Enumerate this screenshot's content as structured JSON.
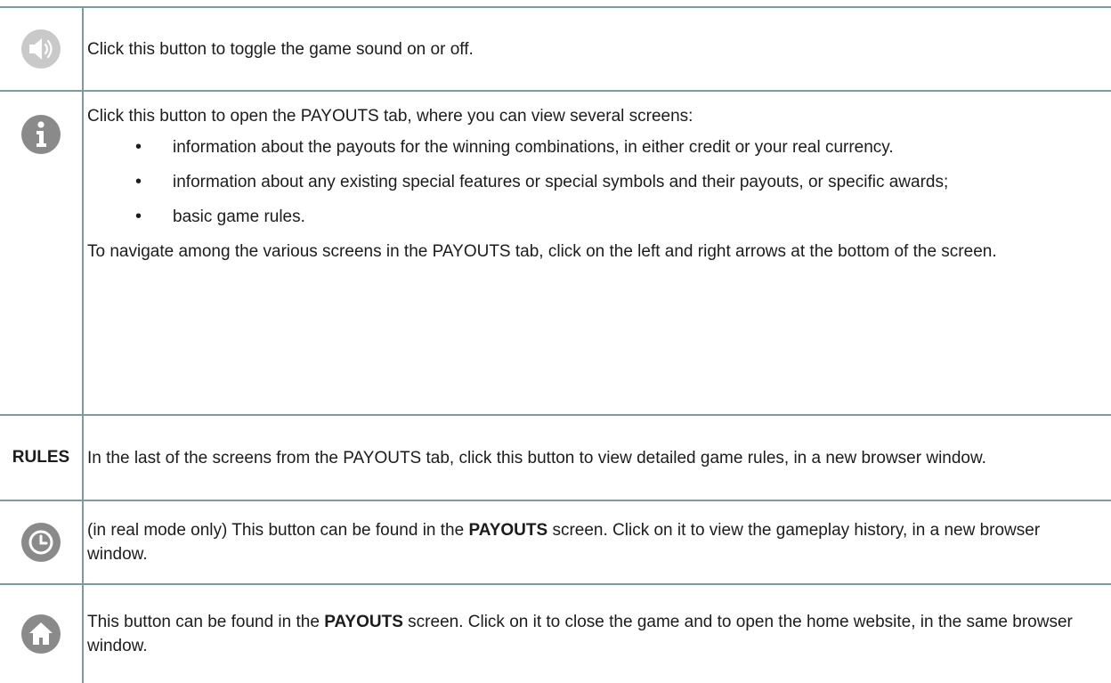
{
  "rows": [
    {
      "icon": "sound-icon",
      "text": "Click this button to toggle the game sound on or off."
    },
    {
      "icon": "info-icon",
      "intro": "Click this button to open the PAYOUTS tab, where you can view several screens:",
      "bullets": [
        "information about the payouts for the winning combinations, in either credit or your real currency.",
        "information about any existing special features or special symbols and their payouts, or specific awards;",
        "basic game rules."
      ],
      "outro": "To navigate among the various screens in the PAYOUTS tab, click on the left and right arrows at the bottom of the screen."
    },
    {
      "label": "RULES",
      "text": "In the last of the screens from the PAYOUTS tab, click this button to view detailed game rules, in a new browser window."
    },
    {
      "icon": "history-clock-icon",
      "text_before": "(in real mode only) This button can be found in the ",
      "bold": "PAYOUTS",
      "text_after": " screen. Click on it to view the gameplay history, in a new browser window."
    },
    {
      "icon": "home-icon",
      "text_before": "This button can be found in the ",
      "bold": "PAYOUTS",
      "text_after": " screen. Click on it to close the game and to open the home website, in the same browser window."
    }
  ],
  "colors": {
    "icon_gray": "#8a8a8a",
    "border": "#7b9b9d"
  }
}
